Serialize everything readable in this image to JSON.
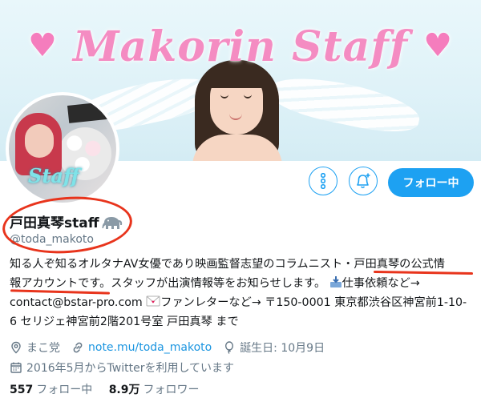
{
  "banner": {
    "title": "Makorin Staff",
    "heart": "♥"
  },
  "avatar": {
    "overlay_text": "Staff"
  },
  "actions": {
    "more_icon": "more-vertical-icon",
    "notify_icon": "bell-plus-icon",
    "follow_label": "フォロー中"
  },
  "profile": {
    "name": "戸田真琴staff",
    "name_emoji": "elephant",
    "handle": "@toda_makoto",
    "bio": {
      "line1_a": "知る人ぞ知るオルタナAV女優であり映画監督志望のコラムニスト・",
      "line1_b": "戸田真琴の公式情",
      "line2_a": "報アカウントです。",
      "line2_b": "スタッフが出演情報等をお知らせします。",
      "line2_c": "仕事依頼など→",
      "line3_a": "contact@bstar-pro.com",
      "line3_b": "ファンレターなど→ 〒150-0001 東京都渋谷区神宮前1-10-",
      "line4": "6 セリジェ神宮前2階201号室 戸田真琴 まで"
    },
    "location": "まこ党",
    "website": "note.mu/toda_makoto",
    "birthday": "誕生日: 10月9日",
    "joined": "2016年5月からTwitterを利用しています"
  },
  "stats": {
    "following_count": "557",
    "following_label": "フォロー中",
    "followers_count": "8.9万",
    "followers_label": "フォロワー"
  },
  "colors": {
    "accent": "#1da1f2",
    "annotation_red": "#e8341c",
    "banner_pink": "#f48cc2",
    "muted": "#657786"
  }
}
